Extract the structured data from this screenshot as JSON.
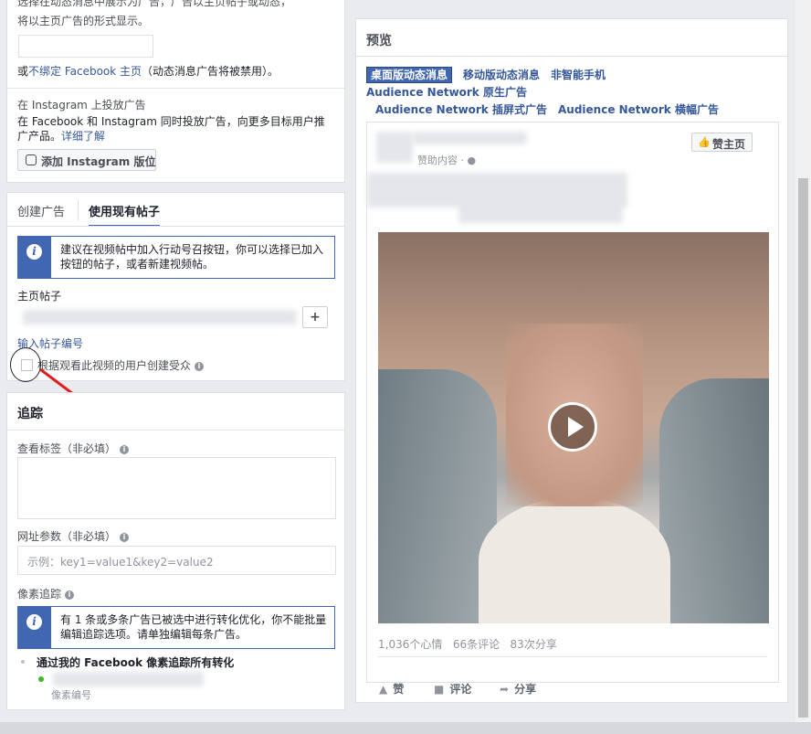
{
  "top_panel": {
    "line1": "选择在动态消息中展示为广告，广告以主页帖子或动态，",
    "line2": "将以主页广告的形式显示。",
    "unbind_prefix": "或",
    "unbind_link": "不绑定 Facebook 主页",
    "unbind_suffix": "（动态消息广告将被禁用）。",
    "instagram_title": "在 Instagram 上投放广告",
    "instagram_desc": "在 Facebook 和 Instagram 同时投放广告，向更多目标用户推广产品。",
    "learn_more": "详细了解",
    "add_instagram_button": "添加 Instagram 版位"
  },
  "creative": {
    "tab_create": "创建广告",
    "tab_existing": "使用现有帖子",
    "video_info": "建议在视频帖中加入行动号召按钮，你可以选择已加入按钮的帖子，或者新建视频帖。",
    "page_post_label": "主页帖子",
    "add_button": "+",
    "enter_post_id": "输入帖子编号",
    "lookalike_label": "根据观看此视频的用户创建受众"
  },
  "tracking": {
    "title": "追踪",
    "view_tags_label": "查看标签（非必填）",
    "url_params_label": "网址参数（非必填）",
    "url_params_placeholder": "示例：key1=value1&key2=value2",
    "pixel_label": "像素追踪",
    "pixel_info": "有 1 条或多条广告已被选中进行转化优化，你不能批量编辑追踪选项。请单独编辑每条广告。",
    "pixel_item": "通过我的 Facebook 像素追踪所有转化",
    "pixel_sub": "像素编号"
  },
  "preview": {
    "title": "预览",
    "tabs": [
      {
        "label": "桌面版动态消息",
        "active": true
      },
      {
        "label": "移动版动态消息",
        "active": false
      },
      {
        "label": "非智能手机",
        "active": false
      },
      {
        "label": "Audience Network 原生广告",
        "active": false
      },
      {
        "label": "Audience Network 插屏式广告",
        "active": false
      },
      {
        "label": "Audience Network 横幅广告",
        "active": false
      }
    ],
    "sponsored": "赞助内容",
    "like_page_button": "赞主页",
    "stats": {
      "reactions": "1,036个心情",
      "comments": "66条评论",
      "shares": "83次分享"
    },
    "actions": {
      "like": "赞",
      "comment": "评论",
      "share": "分享"
    }
  },
  "colors": {
    "accent": "#4267b2",
    "link": "#365899",
    "annotation": "#e02020"
  }
}
